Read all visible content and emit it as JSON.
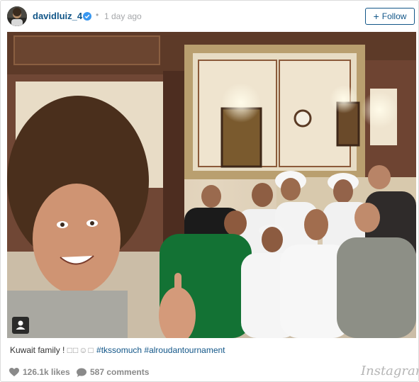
{
  "post": {
    "username": "davidluiz_4",
    "separator": "•",
    "timestamp": "1 day ago",
    "follow_label": "Follow",
    "follow_symbol": "+",
    "caption_text": "Kuwait family ! ",
    "caption_glyphs": "□□☺□",
    "hashtag_1": "#tkssomuch",
    "hashtag_2": "#alroudantournament",
    "likes": "126.1k likes",
    "comments": "587 comments",
    "brand": "Instagram"
  },
  "colors": {
    "link": "#125688",
    "verified": "#3897f0",
    "muted": "#a5a7aa"
  },
  "icons": {
    "verified": "verified-badge-icon",
    "user_tag": "user-tag-icon",
    "like": "heart-icon",
    "comment": "comment-bubble-icon"
  }
}
